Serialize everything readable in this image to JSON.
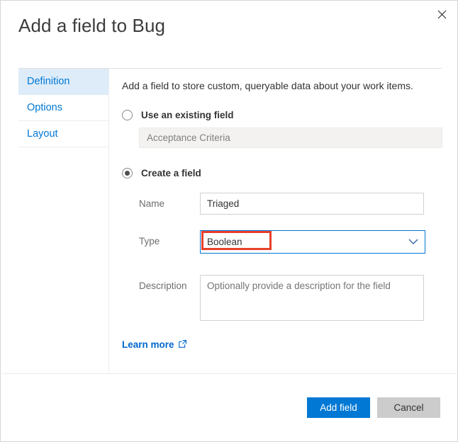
{
  "dialog": {
    "title": "Add a field to Bug",
    "close_label": "Close"
  },
  "sidebar": {
    "items": [
      {
        "label": "Definition",
        "selected": true
      },
      {
        "label": "Options",
        "selected": false
      },
      {
        "label": "Layout",
        "selected": false
      }
    ]
  },
  "content": {
    "intro": "Add a field to store custom, queryable data about your work items.",
    "existing": {
      "radio_label": "Use an existing field",
      "selected": false,
      "field_value": "Acceptance Criteria"
    },
    "create": {
      "radio_label": "Create a field",
      "selected": true,
      "name_label": "Name",
      "name_value": "Triaged",
      "name_placeholder": "",
      "type_label": "Type",
      "type_value": "Boolean",
      "description_label": "Description",
      "description_value": "",
      "description_placeholder": "Optionally provide a description for the field"
    },
    "learn_more": "Learn more"
  },
  "footer": {
    "primary_label": "Add field",
    "secondary_label": "Cancel"
  },
  "colors": {
    "accent": "#0078d4",
    "link": "#0066cc",
    "selected_tab_bg": "#deecf9",
    "annotation": "#e8402a",
    "secondary_button": "#cccccc"
  }
}
